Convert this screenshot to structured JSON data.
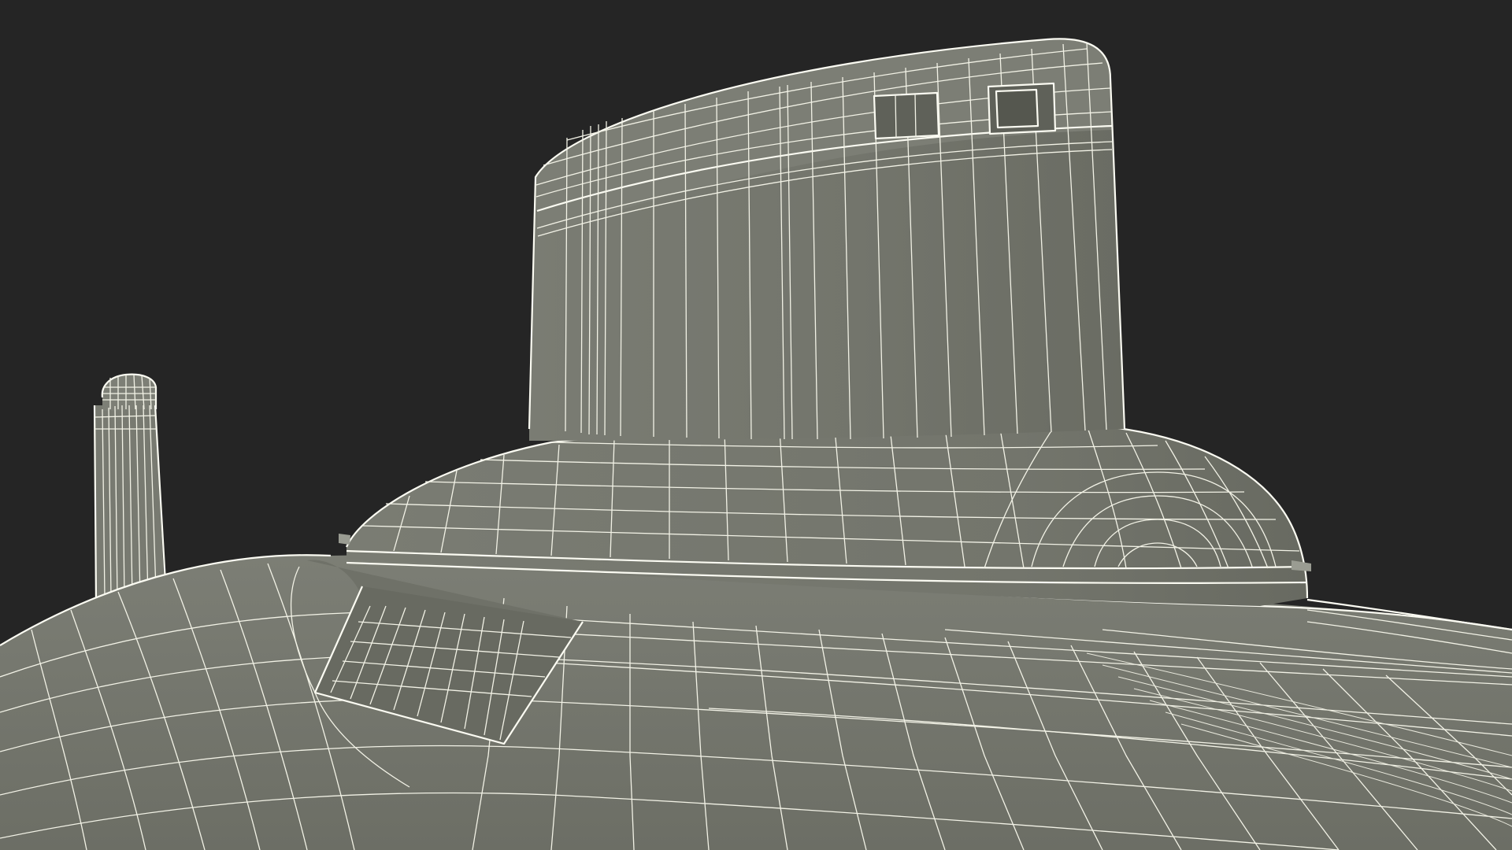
{
  "scene": {
    "subject": "submarine-sail-wireframe",
    "colors": {
      "background": "#252525",
      "hull": "#74766d",
      "hull_dark": "#5f6159",
      "hull_light": "#83857b",
      "wire": "#f2f2e6"
    }
  }
}
